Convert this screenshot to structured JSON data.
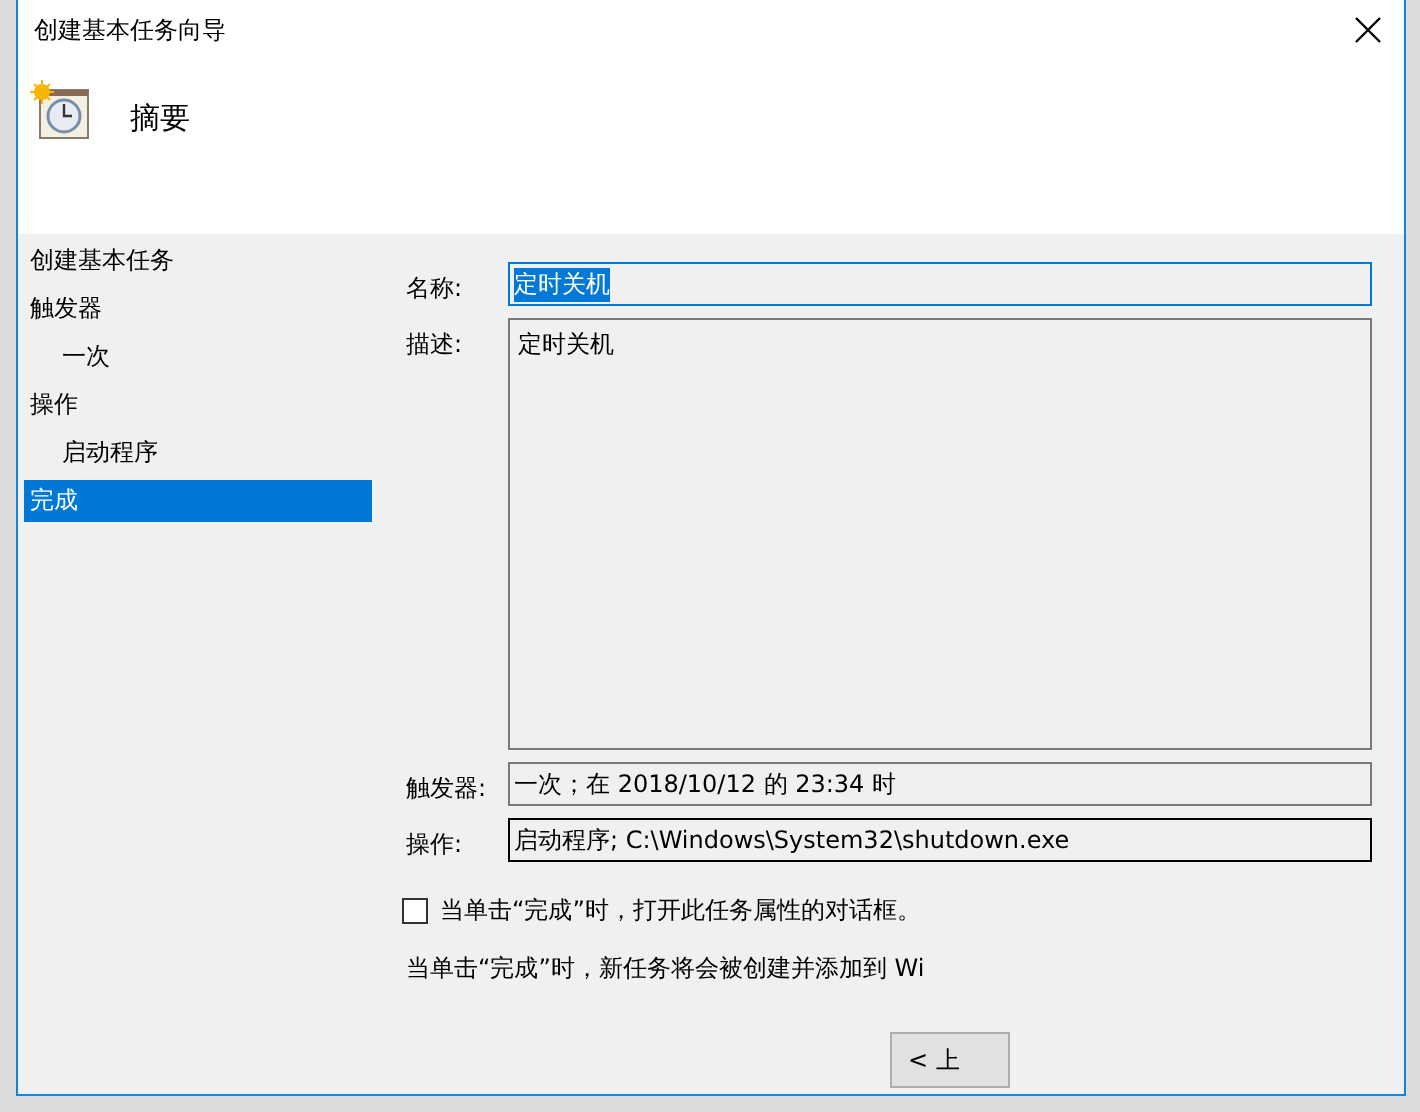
{
  "window": {
    "title": "创建基本任务向导"
  },
  "header": {
    "title": "摘要"
  },
  "sidebar": {
    "items": [
      {
        "label": "创建基本任务",
        "selected": false
      },
      {
        "label": "触发器",
        "selected": false,
        "children": [
          {
            "label": "一次",
            "selected": false
          }
        ]
      },
      {
        "label": "操作",
        "selected": false,
        "children": [
          {
            "label": "启动程序",
            "selected": false
          }
        ]
      },
      {
        "label": "完成",
        "selected": true
      }
    ]
  },
  "fields": [
    {
      "label": "名称:",
      "value": "定时关机",
      "kind": "text",
      "focused": true
    },
    {
      "label": "描述:",
      "value": "定时关机",
      "kind": "multiline",
      "focused": false
    },
    {
      "label": "触发器:",
      "value": "一次；在 2018/10/12 的 23:34 时",
      "kind": "readonly",
      "focused": false
    },
    {
      "label": "操作:",
      "value": "启动程序; C:\\Windows\\System32\\shutdown.exe",
      "kind": "static",
      "focused": false
    }
  ],
  "checkbox": {
    "label": "当单击“完成”时，打开此任务属性的对话框。",
    "checked": false
  },
  "note": "当单击“完成”时，新任务将会被创建并添加到 Wi",
  "buttons": [
    {
      "label": "< 上"
    }
  ]
}
